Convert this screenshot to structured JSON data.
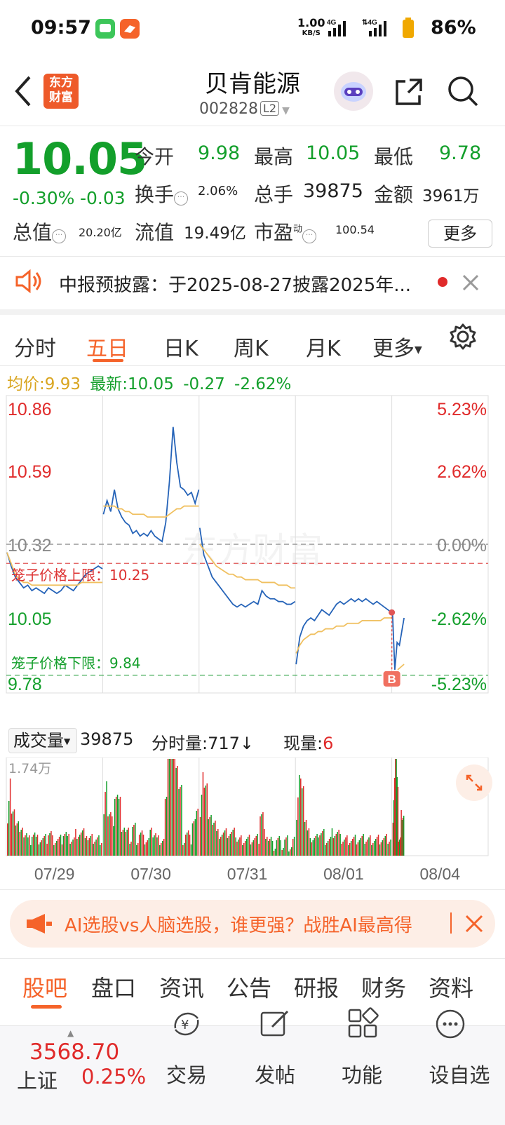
{
  "status_bar": {
    "time": "09:57",
    "net_speed_value": "1.00",
    "net_speed_unit": "KB/S",
    "battery": "86%",
    "sig1": "4G",
    "sig2": "4G"
  },
  "header": {
    "back": "‹",
    "logo_line1": "东方",
    "logo_line2": "财富",
    "title": "贝肯能源",
    "code": "002828",
    "level": "L2"
  },
  "quote": {
    "price": "10.05",
    "change_pct": "-0.30%",
    "change": "-0.03",
    "open_label": "今开",
    "open": "9.98",
    "high_label": "最高",
    "high": "10.05",
    "low_label": "最低",
    "low": "9.78",
    "turnover_label": "换手",
    "turnover": "2.06%",
    "volume_label": "总手",
    "volume": "39875",
    "amount_label": "金额",
    "amount": "3961万",
    "mcap_label": "总值",
    "mcap": "20.20亿",
    "float_label": "流值",
    "float": "19.49亿",
    "pe_label": "市盈",
    "pe_sup": "动",
    "pe": "100.54",
    "more": "更多"
  },
  "notice": {
    "text": "中报预披露：于2025-08-27披露2025年..."
  },
  "chart_tabs": {
    "items": [
      "分时",
      "五日",
      "日K",
      "周K",
      "月K",
      "更多"
    ],
    "active": "五日"
  },
  "chart_header": {
    "avg_label": "均价:",
    "avg": "9.93",
    "last_label": "最新:",
    "last": "10.05",
    "chg": "-0.27",
    "pct": "-2.62%"
  },
  "colors": {
    "up": "#E02A2A",
    "down": "#139F2B",
    "accent": "#F5632A",
    "price_line": "#2563B8",
    "avg_line": "#F0C060"
  },
  "chart_data": {
    "type": "line",
    "title": "",
    "y_labels_left": [
      "10.86",
      "10.59",
      "10.32",
      "10.05",
      "9.78"
    ],
    "y_labels_right": [
      "5.23%",
      "2.62%",
      "0.00%",
      "-2.62%",
      "-5.23%"
    ],
    "ylim": [
      9.78,
      10.86
    ],
    "prev_close": 10.32,
    "limit_up_label": "笼子价格上限：10.25",
    "limit_up": 10.25,
    "limit_down_label": "笼子价格下限：9.84",
    "limit_down": 9.84,
    "buy_marker": "B",
    "days": [
      "07/29",
      "07/30",
      "07/31",
      "08/01",
      "08/04"
    ],
    "series": [
      {
        "values": [
          10.29,
          10.24,
          10.2,
          10.18,
          10.16,
          10.17,
          10.15,
          10.16,
          10.15,
          10.14,
          10.16,
          10.15,
          10.14,
          10.15,
          10.17,
          10.16,
          10.15,
          10.17,
          10.19,
          10.21,
          10.22,
          10.23,
          10.24,
          10.23
        ],
        "avg": [
          10.29,
          10.25,
          10.21,
          10.19,
          10.18,
          10.18,
          10.17,
          10.17,
          10.17,
          10.17,
          10.17,
          10.17,
          10.17,
          10.17,
          10.17,
          10.17,
          10.17,
          10.17,
          10.18,
          10.18,
          10.18,
          10.18,
          10.18,
          10.18
        ]
      },
      {
        "values": [
          10.43,
          10.48,
          10.44,
          10.52,
          10.45,
          10.42,
          10.4,
          10.39,
          10.36,
          10.37,
          10.35,
          10.36,
          10.35,
          10.37,
          10.35,
          10.34,
          10.33,
          10.4,
          10.55,
          10.75,
          10.62,
          10.53,
          10.52,
          10.5,
          10.51,
          10.47,
          10.52
        ],
        "avg": [
          10.46,
          10.46,
          10.46,
          10.46,
          10.45,
          10.45,
          10.44,
          10.44,
          10.43,
          10.43,
          10.43,
          10.43,
          10.42,
          10.42,
          10.42,
          10.42,
          10.42,
          10.42,
          10.43,
          10.44,
          10.45,
          10.45,
          10.46,
          10.46,
          10.46,
          10.46,
          10.46
        ]
      },
      {
        "values": [
          10.38,
          10.28,
          10.24,
          10.2,
          10.18,
          10.16,
          10.14,
          10.12,
          10.1,
          10.09,
          10.1,
          10.09,
          10.1,
          10.11,
          10.1,
          10.15,
          10.13,
          10.12,
          10.12,
          10.11,
          10.11,
          10.1,
          10.1,
          10.11
        ],
        "avg": [
          10.32,
          10.3,
          10.28,
          10.26,
          10.24,
          10.23,
          10.22,
          10.21,
          10.21,
          10.2,
          10.2,
          10.19,
          10.19,
          10.19,
          10.19,
          10.18,
          10.18,
          10.18,
          10.18,
          10.17,
          10.17,
          10.17,
          10.16,
          10.16
        ]
      },
      {
        "values": [
          9.88,
          9.98,
          10.02,
          10.04,
          10.05,
          10.04,
          10.06,
          10.08,
          10.07,
          10.06,
          10.08,
          10.1,
          10.11,
          10.1,
          10.11,
          10.12,
          10.11,
          10.12,
          10.11,
          10.12,
          10.11,
          10.1,
          10.11,
          10.1,
          10.09,
          10.08,
          10.07
        ],
        "avg": [
          9.92,
          9.95,
          9.97,
          9.98,
          9.99,
          9.99,
          10.0,
          10.0,
          10.01,
          10.01,
          10.01,
          10.02,
          10.02,
          10.02,
          10.03,
          10.03,
          10.03,
          10.03,
          10.04,
          10.04,
          10.04,
          10.04,
          10.04,
          10.04,
          10.05,
          10.05,
          10.05
        ]
      },
      {
        "values": [
          10.07,
          9.86,
          9.96,
          9.95,
          10.0,
          10.05
        ],
        "avg": [
          9.86,
          9.87,
          9.88
        ]
      }
    ]
  },
  "volume": {
    "label": "成交量",
    "total": "39875",
    "min_vol_label": "分时量:",
    "min_vol": "717",
    "arrow": "↓",
    "cur_label": "现量:",
    "cur": "6",
    "max": "1.74万"
  },
  "ai_banner": {
    "text": "AI选股vs人脑选股，谁更强？战胜AI最高得"
  },
  "bottom_tabs": {
    "items": [
      "股吧",
      "盘口",
      "资讯",
      "公告",
      "研报",
      "财务",
      "资料"
    ],
    "active": "股吧"
  },
  "footer": {
    "index_value": "3568.70",
    "index_name": "上证",
    "index_pct": "0.25%",
    "trade": "交易",
    "post": "发帖",
    "func": "功能",
    "watch": "设自选"
  }
}
